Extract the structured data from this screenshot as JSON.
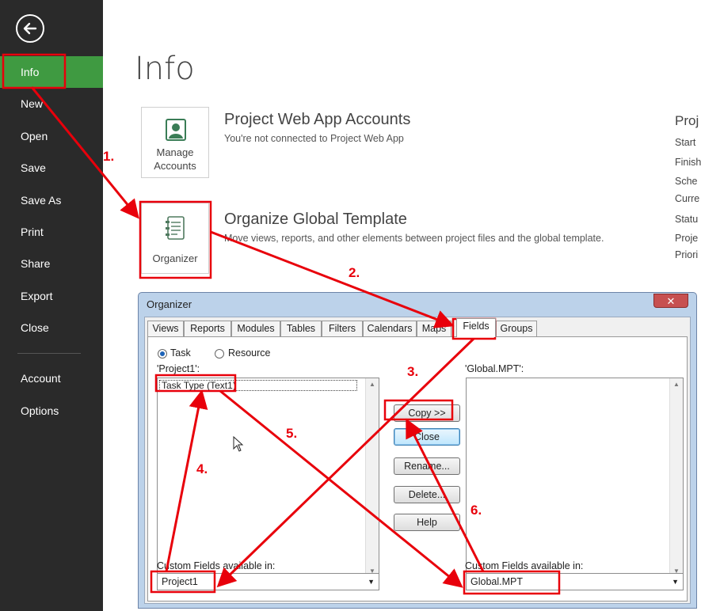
{
  "sidebar": {
    "back_icon": "back-arrow-icon",
    "items": [
      {
        "label": "Info",
        "active": true
      },
      {
        "label": "New"
      },
      {
        "label": "Open"
      },
      {
        "label": "Save"
      },
      {
        "label": "Save As"
      },
      {
        "label": "Print"
      },
      {
        "label": "Share"
      },
      {
        "label": "Export"
      },
      {
        "label": "Close"
      },
      {
        "label": "Account"
      },
      {
        "label": "Options"
      }
    ]
  },
  "main": {
    "title": "Info",
    "accounts": {
      "button_line1": "Manage",
      "button_line2": "Accounts",
      "title": "Project Web App Accounts",
      "desc": "You're not connected to Project Web App"
    },
    "organizer": {
      "button_label": "Organizer",
      "title": "Organize Global Template",
      "desc": "Move views, reports, and other elements between project files and the global template."
    },
    "properties": {
      "heading": "Proj",
      "labels": [
        "Start",
        "Finish",
        "Sche",
        "Curre",
        "Statu",
        "Proje",
        "Priori"
      ]
    }
  },
  "dialog": {
    "title": "Organizer",
    "close_glyph": "✕",
    "tabs": [
      "Views",
      "Reports",
      "Modules",
      "Tables",
      "Filters",
      "Calendars",
      "Maps",
      "Fields",
      "Groups"
    ],
    "selected_tab": "Fields",
    "radio_task": "Task",
    "radio_resource": "Resource",
    "left_label": "'Project1':",
    "right_label": "'Global.MPT':",
    "left_items": [
      "Task Type (Text1)"
    ],
    "buttons": {
      "copy": "Copy >>",
      "close": "Close",
      "rename": "Rename...",
      "delete": "Delete...",
      "help": "Help"
    },
    "left_available_label": "Custom Fields available in:",
    "right_available_label": "Custom Fields available in:",
    "left_combo_value": "Project1",
    "right_combo_value": "Global.MPT"
  },
  "annotations": {
    "accent": "#e8000b",
    "steps": [
      "1.",
      "2.",
      "3.",
      "4.",
      "5.",
      "6."
    ]
  }
}
